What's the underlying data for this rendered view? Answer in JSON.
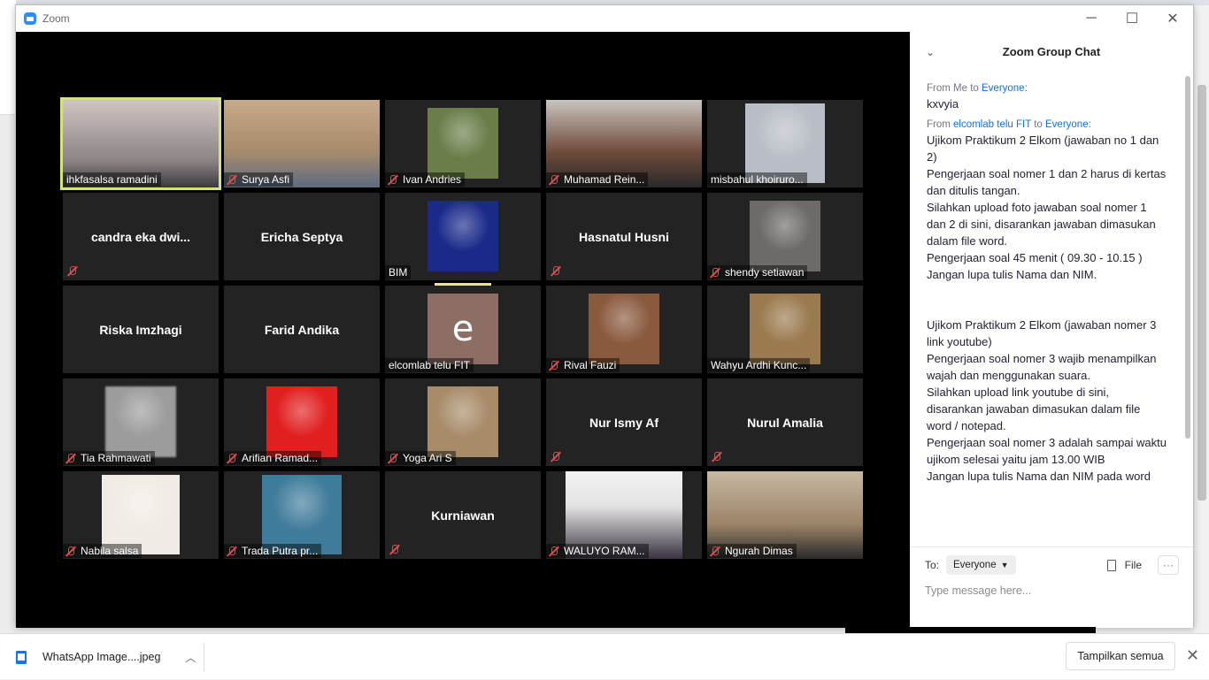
{
  "window": {
    "title": "Zoom",
    "minimize": "─",
    "maximize": "☐",
    "close": "✕"
  },
  "participants": [
    {
      "name": "ihkfasalsa ramadini",
      "muted": false,
      "mode": "video",
      "active": true
    },
    {
      "name": "Surya Asfi",
      "muted": true,
      "mode": "video"
    },
    {
      "name": "Ivan Andries",
      "muted": true,
      "mode": "photo"
    },
    {
      "name": "Muhamad Rein...",
      "muted": true,
      "mode": "video"
    },
    {
      "name": "misbahul khoiruro...",
      "muted": false,
      "mode": "photo"
    },
    {
      "name": "candra eka dwi...",
      "muted": true,
      "mode": "name"
    },
    {
      "name": "Ericha Septya",
      "muted": false,
      "mode": "name"
    },
    {
      "name": "BIM",
      "muted": false,
      "mode": "photo",
      "speaking": true
    },
    {
      "name": "Hasnatul Husni",
      "muted": true,
      "mode": "name"
    },
    {
      "name": "shendy setiawan",
      "muted": true,
      "mode": "photo"
    },
    {
      "name": "Riska Imzhagi",
      "muted": false,
      "mode": "name"
    },
    {
      "name": "Farid Andika",
      "muted": false,
      "mode": "name"
    },
    {
      "name": "elcomlab telu FIT",
      "muted": false,
      "mode": "avatar",
      "avatar_letter": "e"
    },
    {
      "name": "Rival Fauzi",
      "muted": true,
      "mode": "photo"
    },
    {
      "name": "Wahyu Ardhi Kunc...",
      "muted": false,
      "mode": "photo"
    },
    {
      "name": "Tia Rahmawati",
      "muted": true,
      "mode": "photo"
    },
    {
      "name": "Arifian Ramad...",
      "muted": true,
      "mode": "photo"
    },
    {
      "name": "Yoga Ari S",
      "muted": true,
      "mode": "photo"
    },
    {
      "name": "Nur Ismy Af",
      "muted": true,
      "mode": "name"
    },
    {
      "name": "Nurul Amalia",
      "muted": true,
      "mode": "name"
    },
    {
      "name": "Nabila salsa",
      "muted": true,
      "mode": "photo"
    },
    {
      "name": "Trada Putra pr...",
      "muted": true,
      "mode": "photo"
    },
    {
      "name": "Kurniawan",
      "muted": true,
      "mode": "name"
    },
    {
      "name": "WALUYO RAM...",
      "muted": true,
      "mode": "video"
    },
    {
      "name": "Ngurah Dimas",
      "muted": true,
      "mode": "video"
    }
  ],
  "chat": {
    "title": "Zoom Group Chat",
    "messages": [
      {
        "from_prefix": "From ",
        "from": "Me",
        "to_prefix": " to ",
        "to": "Everyone:",
        "text": "kxvyia"
      },
      {
        "from_prefix": "From ",
        "from": "elcomlab telu FIT",
        "to_prefix": " to ",
        "to": "Everyone:",
        "text": "Ujikom Praktikum 2 Elkom (jawaban no 1 dan 2)\nPengerjaan soal nomer 1 dan 2 harus di kertas dan ditulis tangan.\nSilahkan upload foto jawaban soal nomer 1 dan 2 di sini, disarankan jawaban dimasukan dalam file word.\nPengerjaan soal 45 menit ( 09.30 - 10.15 )\nJangan lupa tulis Nama dan NIM.\n\n\nUjikom Praktikum 2 Elkom (jawaban nomer 3 link youtube)\nPengerjaan soal nomer 3 wajib menampilkan wajah dan menggunakan suara.\nSilahkan upload link youtube di sini, disarankan jawaban dimasukan dalam file word / notepad.\nPengerjaan soal nomer 3 adalah sampai waktu ujikom selesai yaitu jam 13.00 WIB\nJangan lupa tulis Nama dan NIM pada word"
      }
    ],
    "to_label": "To:",
    "to_value": "Everyone",
    "file_label": "File",
    "more_label": "···",
    "input_placeholder": "Type message here..."
  },
  "downloads": {
    "file_name": "WhatsApp Image....jpeg",
    "show_all": "Tampilkan semua",
    "close": "✕"
  },
  "colors": {
    "accent": "#0e71eb",
    "mute": "#e24b4b",
    "active_border": "#d6e37c"
  }
}
